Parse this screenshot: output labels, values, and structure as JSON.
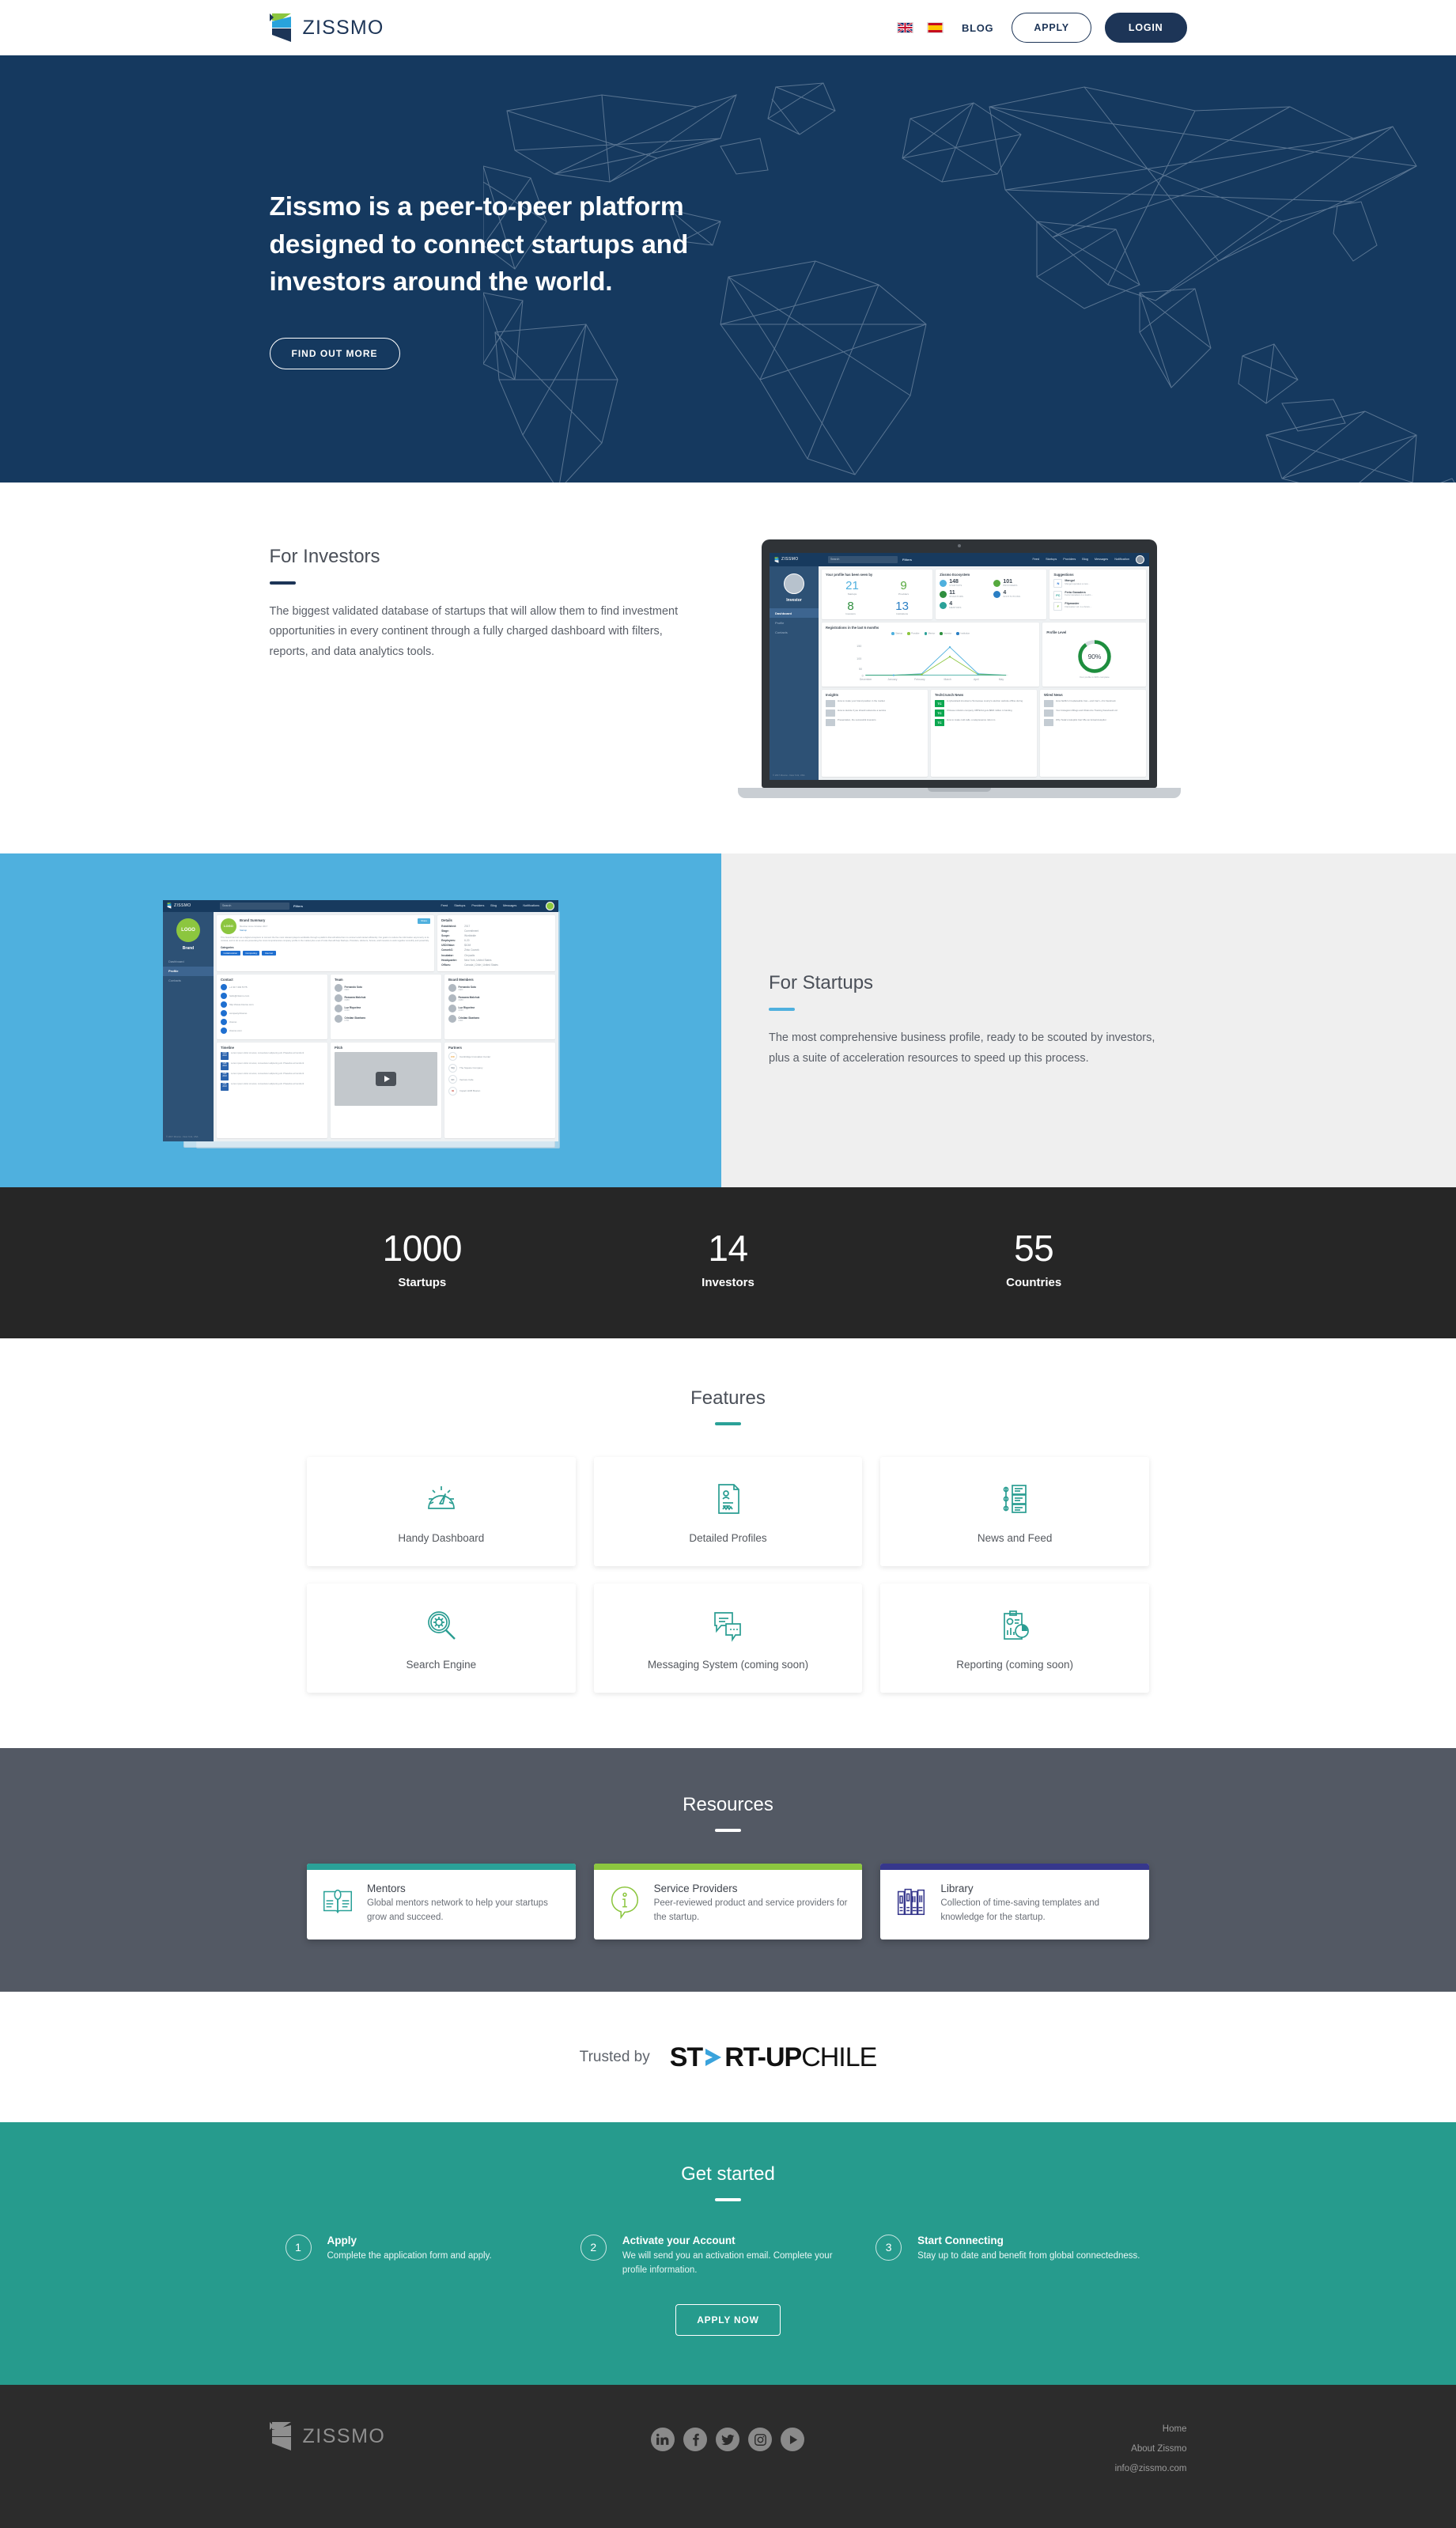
{
  "header": {
    "logo_text": "ZISSMO",
    "lang_en": "en-flag-icon",
    "lang_es": "es-flag-icon",
    "blog": "BLOG",
    "apply": "APPLY",
    "login": "LOGIN"
  },
  "hero": {
    "title": "Zissmo is a peer-to-peer platform designed to connect startups and investors around the world.",
    "cta": "FIND OUT MORE",
    "bg_color": "#15395f"
  },
  "investors": {
    "heading": "For Investors",
    "body": "The biggest validated database of startups that will allow them to find investment opportunities in every continent through a fully charged dashboard with filters, reports, and data analytics tools.",
    "rule_color": "#1d3557",
    "dashboard": {
      "logo": "ZISSMO",
      "search_placeholder": "Search",
      "filters": "Filters",
      "nav": [
        "Feed",
        "Startups",
        "Providers",
        "Blog",
        "Messages",
        "Notification"
      ],
      "side_name": "Investor",
      "side_items": [
        "Dashboard",
        "Profile",
        "Contacts"
      ],
      "side_footer": "© 2017 Zissmo - New York, USA",
      "seen_by_title": "Your profile has been seen by",
      "seen_by": [
        {
          "value": "21",
          "label": "Startups",
          "color": "#4fb0de"
        },
        {
          "value": "9",
          "label": "Providers",
          "color": "#56a93e"
        },
        {
          "value": "8",
          "label": "Investors",
          "color": "#2f8f3f"
        },
        {
          "value": "13",
          "label": "Institutions",
          "color": "#2b7fc4"
        }
      ],
      "eco_title": "Zissmo Ecosystem",
      "ecosystem": [
        {
          "value": "148",
          "label": "STARTUPS",
          "color": "#4fb0de"
        },
        {
          "value": "101",
          "label": "PROVIDERS",
          "color": "#56a93e"
        },
        {
          "value": "11",
          "label": "INVESTORS",
          "color": "#2f8f3f"
        },
        {
          "value": "4",
          "label": "INSTITUTIONS",
          "color": "#2b7fc4"
        },
        {
          "value": "4",
          "label": "MENTORS",
          "color": "#2aa198"
        }
      ],
      "sug_title": "Suggestions",
      "suggestions": [
        {
          "badge": "N",
          "name": "Mangol",
          "desc": "Mangol operates a new...",
          "color": "#1f6fd0"
        },
        {
          "badge": "FC",
          "name": "Feria Ganadera",
          "desc": "Feria Ganadera is a leadin...",
          "color": "#2aa198"
        },
        {
          "badge": "F",
          "name": "Filpmaster",
          "desc": "Filpmaster Ltd. is a future...",
          "color": "#8cc63f"
        }
      ],
      "chart_title": "Registrations in the last 6 months",
      "profile_level_title": "Profile Level",
      "profile_pct": "90%",
      "profile_note": "Your profile is 90% complete",
      "insights_title": "Insights",
      "insights": [
        "How to make your brand position in the market",
        "How to decide if you should outsource a service",
        "Presentation, the successful investors"
      ],
      "tc_title": "TechCrunch News",
      "tc_news": [
        "A cyberattack knocked a Tennessee county's election website offline during",
        "Chinese robotics company UBTECH gets $820 million in funding",
        "How to make cold calls, a telepresence robot co"
      ],
      "wired_title": "Wired News",
      "wired_news": [
        "How Netflix's Irreplaceable Can—and Can't—Fix Facebook",
        "Your Instagram #Dogs and #Cats Are Training Facebook's AI",
        "Why Tesla's Autopilot Can't Be an Actual Autopilot"
      ]
    }
  },
  "startups": {
    "heading": "For Startups",
    "body": "The most comprehensive business profile, ready to be scouted by investors, plus a suite of acceleration resources to speed up this process.",
    "rule_color": "#4fb0de",
    "bg_left": "#4fb0de",
    "bg_right": "#efefef",
    "profile": {
      "logo": "ZISSMO",
      "search_placeholder": "Search",
      "filters": "Filters",
      "nav": [
        "Feed",
        "Startups",
        "Providers",
        "Blog",
        "Messages",
        "Notifications"
      ],
      "side_logo": "LOGO",
      "side_name": "Brand",
      "side_items": [
        "Dashboard",
        "Profile",
        "Contacts"
      ],
      "side_footer": "© 2017 Zissmo - New York, USA",
      "brand_summary_title": "Brand Summary",
      "member_since": "Member since October 2017",
      "member_tag": "Startup",
      "share": "Share",
      "summary": "This brand has born as a digital ecosystem to connect the five most relevant players worldwide through a platform that will allow them to connect and interact efficiently. Our goal is to reduce the information asymmetry to its minimal, and to do so we are presenting the most comprehensive company profile in the market plus a set of tools that will help Startups, Providers, Advisors, Scouts, and Investors to work together smoothly and powerfully.",
      "categories_title": "Categories",
      "categories": [
        "Collaboration",
        "Computing",
        "Internet"
      ],
      "details_title": "Details",
      "details": [
        {
          "k": "Established:",
          "v": "2017"
        },
        {
          "k": "Stage:",
          "v": "Commitment"
        },
        {
          "k": "Scope:",
          "v": "Worldwide"
        },
        {
          "k": "Employees:",
          "v": "6-20"
        },
        {
          "k": "USD/Value:",
          "v": "$10M"
        },
        {
          "k": "CoworkC:",
          "v": "Zirko Cowork"
        },
        {
          "k": "Incubator:",
          "v": "Chrysalis"
        },
        {
          "k": "Headquarter:",
          "v": "New York, United States"
        },
        {
          "k": "Offices:",
          "v": "Canada | Chile | United States"
        }
      ],
      "contact_title": "Contact",
      "contacts": [
        "+1 917 303 5775",
        "hello@zissmo.com",
        "http://www.zissmo.com",
        "company/zissmo",
        "zissmo",
        "zissmo.com"
      ],
      "team_title": "Team",
      "team": [
        {
          "n": "Fernando Soto",
          "r": "CEO"
        },
        {
          "n": "Rossana Malchuk",
          "r": "CMO"
        },
        {
          "n": "Luz Riquelme",
          "r": "COO"
        },
        {
          "n": "Cristian Sbarbaro",
          "r": "CTO"
        }
      ],
      "board_title": "Board Members",
      "board": [
        {
          "n": "Fernando Soto",
          "r": "CEO"
        },
        {
          "n": "Rossana Malchuk",
          "r": "CMO"
        },
        {
          "n": "Luz Riquelme",
          "r": "COO"
        },
        {
          "n": "Cristian Sbarbaro",
          "r": "CSO"
        }
      ],
      "timeline_title": "Timeline",
      "timeline": [
        {
          "d": "MAR 2018",
          "t": "Lorem ipsum dolor sit amet, consectetur adipiscing elit. Phasellus at hendrerit"
        },
        {
          "d": "FEB 2018",
          "t": "Lorem ipsum dolor sit amet, consectetur adipiscing elit. Phasellus at hendrerit"
        },
        {
          "d": "FEB 2018",
          "t": "Lorem ipsum dolor sit amet, consectetur adipiscing elit. Phasellus at hendrerit"
        },
        {
          "d": "FEB 2018",
          "t": "Lorem ipsum dolor sit amet, consectetur adipiscing elit. Phasellus at hendrerit"
        }
      ],
      "pitch_title": "Pitch",
      "partners_title": "Partners",
      "partners": [
        {
          "b": "CIC",
          "n": "Cambridge Innovation Center"
        },
        {
          "b": "SQ",
          "n": "The Square Company"
        },
        {
          "b": "VC",
          "n": "Venture Cafe"
        },
        {
          "b": "IH",
          "n": "Impact HUB Boston"
        }
      ]
    }
  },
  "stats": {
    "bg_color": "#262626",
    "items": [
      {
        "value": "1000",
        "label": "Startups"
      },
      {
        "value": "14",
        "label": "Investors"
      },
      {
        "value": "55",
        "label": "Countries"
      }
    ]
  },
  "features": {
    "heading": "Features",
    "rule_color": "#2aa198",
    "items": [
      {
        "label": "Handy Dashboard",
        "icon": "gauge-icon"
      },
      {
        "label": "Detailed Profiles",
        "icon": "document-profile-icon"
      },
      {
        "label": "News and Feed",
        "icon": "news-feed-icon"
      },
      {
        "label": "Search Engine",
        "icon": "magnifier-gear-icon"
      },
      {
        "label": "Messaging System (coming soon)",
        "icon": "chat-bubbles-icon"
      },
      {
        "label": "Reporting (coming soon)",
        "icon": "report-chart-icon"
      }
    ]
  },
  "resources": {
    "heading": "Resources",
    "bg_color": "#535964",
    "rule_color": "#ffffff",
    "items": [
      {
        "title": "Mentors",
        "desc": "Global mentors network to help your startups grow and succeed.",
        "accent": "#2aa198",
        "icon": "open-book-icon"
      },
      {
        "title": "Service Providers",
        "desc": "Peer-reviewed product and service providers for the startup.",
        "accent": "#8cc63f",
        "icon": "info-bubble-icon"
      },
      {
        "title": "Library",
        "desc": "Collection of time-saving templates and knowledge for the startup.",
        "accent": "#36378c",
        "icon": "books-icon"
      }
    ]
  },
  "trusted": {
    "label": "Trusted by",
    "logo_pre": "ST",
    "logo_mid": "RT-UP",
    "logo_post": "CHILE",
    "chevron_color": "#3aa3dc"
  },
  "getstarted": {
    "heading": "Get started",
    "bg_color": "#269b8d",
    "rule_color": "#ffffff",
    "steps": [
      {
        "num": "1",
        "title": "Apply",
        "desc": "Complete the application form and apply."
      },
      {
        "num": "2",
        "title": "Activate your Account",
        "desc": "We will send you an activation email. Complete your profile information."
      },
      {
        "num": "3",
        "title": "Start Connecting",
        "desc": "Stay up to date and benefit from global connectedness."
      }
    ],
    "cta": "APPLY NOW"
  },
  "footer": {
    "bg_color": "#2c2c2c",
    "logo_text": "ZISSMO",
    "socials": [
      "linkedin-icon",
      "facebook-icon",
      "twitter-icon",
      "instagram-icon",
      "youtube-icon"
    ],
    "links": [
      "Home",
      "About Zissmo",
      "info@zissmo.com"
    ]
  }
}
